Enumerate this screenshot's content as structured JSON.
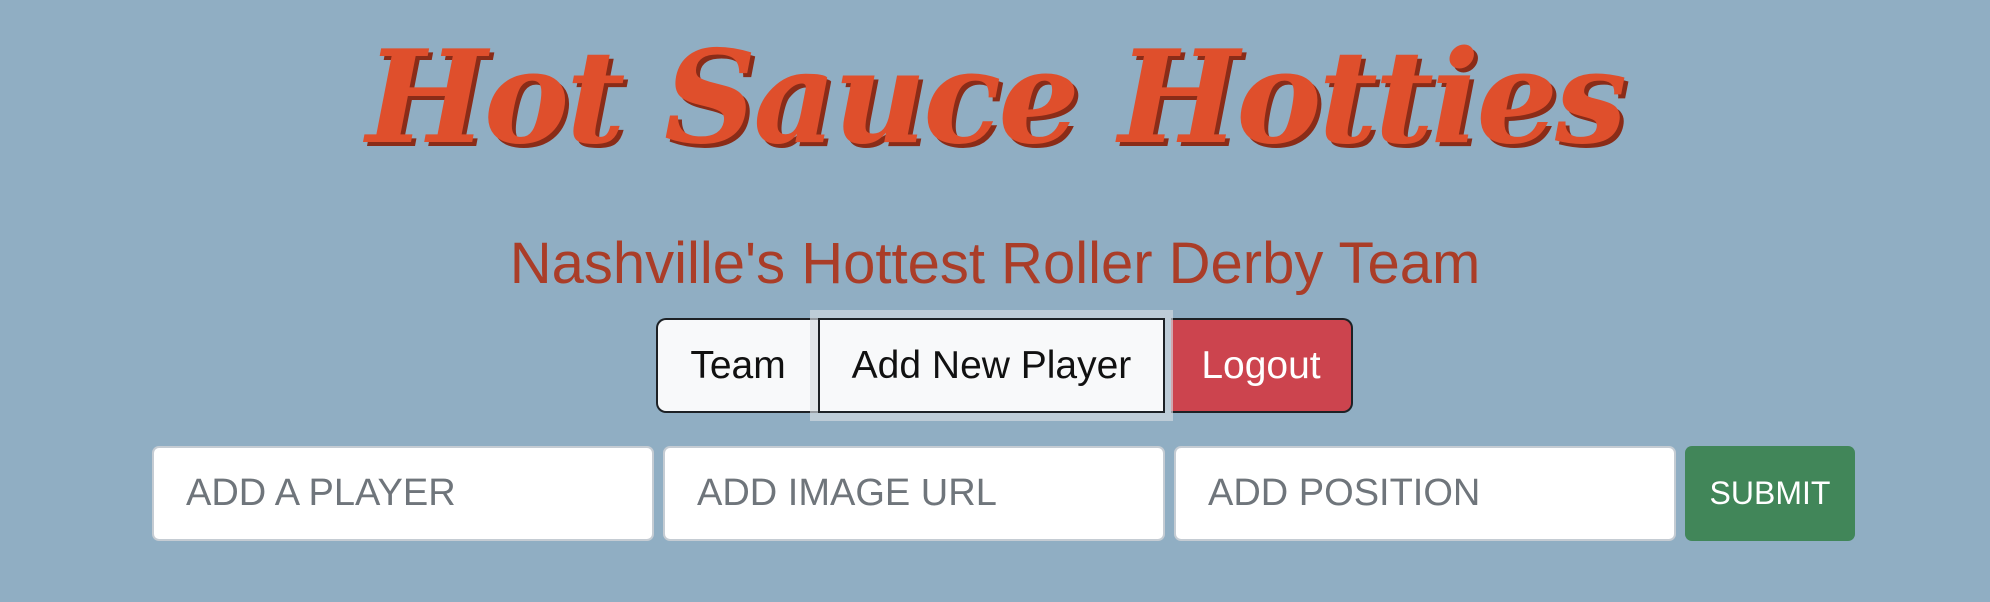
{
  "header": {
    "title": "Hot Sauce Hotties",
    "subtitle": "Nashville's Hottest Roller Derby Team"
  },
  "nav": {
    "team_label": "Team",
    "add_player_label": "Add New Player",
    "logout_label": "Logout"
  },
  "form": {
    "player_placeholder": "ADD A PLAYER",
    "image_url_placeholder": "ADD IMAGE URL",
    "position_placeholder": "ADD POSITION",
    "player_value": "",
    "image_url_value": "",
    "position_value": "",
    "submit_label": "SUBMIT"
  },
  "colors": {
    "background": "#90aec3",
    "title": "#df4f2c",
    "subtitle": "#aa3d28",
    "logout": "#cc444e",
    "submit": "#418659"
  }
}
